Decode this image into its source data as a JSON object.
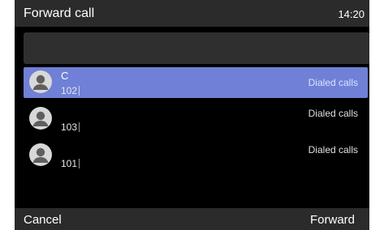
{
  "header": {
    "title": "Forward call",
    "time": "14:20"
  },
  "search": {
    "value": "",
    "placeholder": ""
  },
  "contacts": [
    {
      "name": "C",
      "number": "102",
      "type": "Dialed calls",
      "selected": true,
      "icon": "person-avatar-icon"
    },
    {
      "name": "",
      "number": "103",
      "type": "Dialed calls",
      "selected": false,
      "icon": "person-avatar-icon"
    },
    {
      "name": "",
      "number": "101",
      "type": "Dialed calls",
      "selected": false,
      "icon": "person-avatar-icon"
    }
  ],
  "softkeys": {
    "left": "Cancel",
    "right": "Forward"
  },
  "colors": {
    "background": "#000000",
    "bar": "#2b2b2b",
    "highlight": "#6f80d6",
    "search_field": "#2f2f2f",
    "avatar": "#d8d8d8"
  }
}
